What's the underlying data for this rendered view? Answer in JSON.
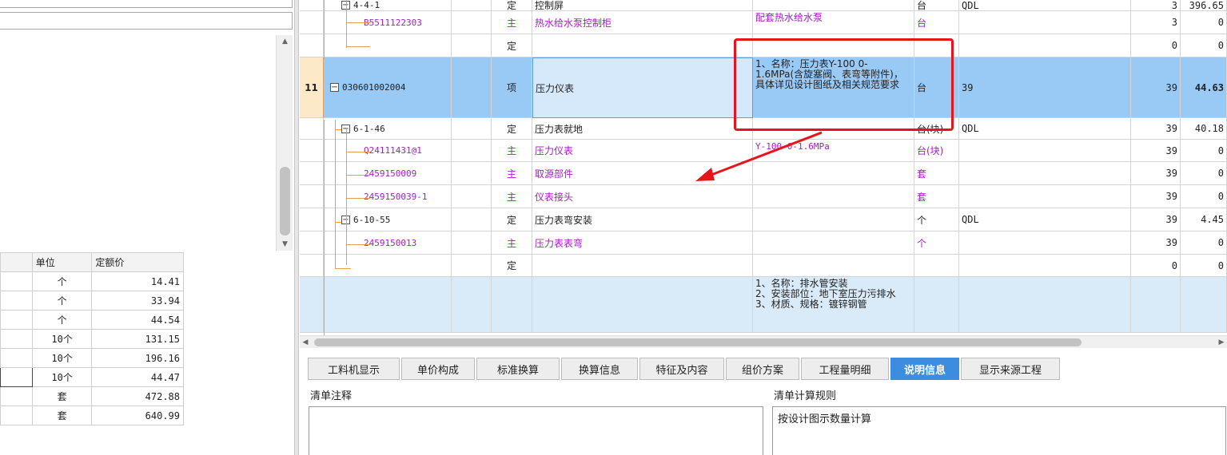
{
  "lower_grid": {
    "headers": [
      "",
      "单位",
      "定额价"
    ],
    "rows": [
      {
        "unit": "个",
        "price": "14.41"
      },
      {
        "unit": "个",
        "price": "33.94"
      },
      {
        "unit": "个",
        "price": "44.54"
      },
      {
        "unit": "10个",
        "price": "131.15"
      },
      {
        "unit": "10个",
        "price": "196.16"
      },
      {
        "unit": "10个",
        "price": "44.47"
      },
      {
        "unit": "套",
        "price": "472.88"
      },
      {
        "unit": "套",
        "price": "640.99"
      }
    ]
  },
  "main_grid": {
    "rows": [
      {
        "num": "",
        "code": "4-4-1",
        "type": "定",
        "name": "控制屏",
        "feature": "",
        "unit": "台",
        "expr": "QDL",
        "qty": "3",
        "price": "396.65",
        "color": "black",
        "expander": true
      },
      {
        "num": "",
        "code": "B5511122303",
        "type": "主",
        "name": "热水给水泵控制柜",
        "feature": "配套热水给水泵",
        "unit": "台",
        "expr": "",
        "qty": "3",
        "price": "0",
        "color": "purple",
        "expander": false
      },
      {
        "num": "",
        "code": "",
        "type": "定",
        "name": "",
        "feature": "",
        "unit": "",
        "expr": "",
        "qty": "0",
        "price": "0",
        "color": "black",
        "expander": false
      },
      {
        "num": "11",
        "code": "030601002004",
        "type": "项",
        "name": "压力仪表",
        "feature": "1、名称：压力表Y-100 0-1.6MPa(含旋塞阀、表弯等附件)，具体详见设计图纸及相关规范要求",
        "unit": "台",
        "expr": "39",
        "qty": "39",
        "price": "44.63",
        "color": "black",
        "expander": true
      },
      {
        "num": "",
        "code": "6-1-46",
        "type": "定",
        "name": "压力表就地",
        "feature": "",
        "unit": "台(块)",
        "expr": "QDL",
        "qty": "39",
        "price": "40.18",
        "color": "black",
        "expander": true
      },
      {
        "num": "",
        "code": "Q24111431@1",
        "type": "主",
        "name": "压力仪表",
        "feature": "Y-100 0-1.6MPa",
        "unit": "台(块)",
        "expr": "",
        "qty": "39",
        "price": "0",
        "color": "purple",
        "expander": false
      },
      {
        "num": "",
        "code": "2459150009",
        "type": "主",
        "name": "取源部件",
        "feature": "",
        "unit": "套",
        "expr": "",
        "qty": "39",
        "price": "0",
        "color": "purple",
        "expander": false
      },
      {
        "num": "",
        "code": "2459150039-1",
        "type": "主",
        "name": "仪表接头",
        "feature": "",
        "unit": "套",
        "expr": "",
        "qty": "39",
        "price": "0",
        "color": "purple",
        "expander": false
      },
      {
        "num": "",
        "code": "6-10-55",
        "type": "定",
        "name": "压力表弯安装",
        "feature": "",
        "unit": "个",
        "expr": "QDL",
        "qty": "39",
        "price": "4.45",
        "color": "black",
        "expander": true
      },
      {
        "num": "",
        "code": "2459150013",
        "type": "主",
        "name": "压力表表弯",
        "feature": "",
        "unit": "个",
        "expr": "",
        "qty": "39",
        "price": "0",
        "color": "purple",
        "expander": false
      },
      {
        "num": "",
        "code": "",
        "type": "定",
        "name": "",
        "feature": "",
        "unit": "",
        "expr": "",
        "qty": "0",
        "price": "0",
        "color": "black",
        "expander": false
      },
      {
        "num": "",
        "code": "",
        "type": "",
        "name": "",
        "feature": "1、名称：排水管安装\n2、安装部位：地下室压力污排水\n3、材质、规格：镀锌钢管",
        "unit": "",
        "expr": "",
        "qty": "",
        "price": "",
        "color": "black",
        "expander": false
      }
    ]
  },
  "tabs": [
    "工料机显示",
    "单价构成",
    "标准换算",
    "换算信息",
    "特征及内容",
    "组价方案",
    "工程量明细",
    "说明信息",
    "显示来源工程"
  ],
  "active_tab": "说明信息",
  "notes": {
    "note_label": "清单注释",
    "rule_label": "清单计算规则",
    "rule_text": "按设计图示数量计算"
  },
  "colors": {
    "selected_row": "#99c9f5",
    "highlight_box": "#e8141c",
    "active_tab": "#3c8de0",
    "main_material": "#a020c0"
  }
}
